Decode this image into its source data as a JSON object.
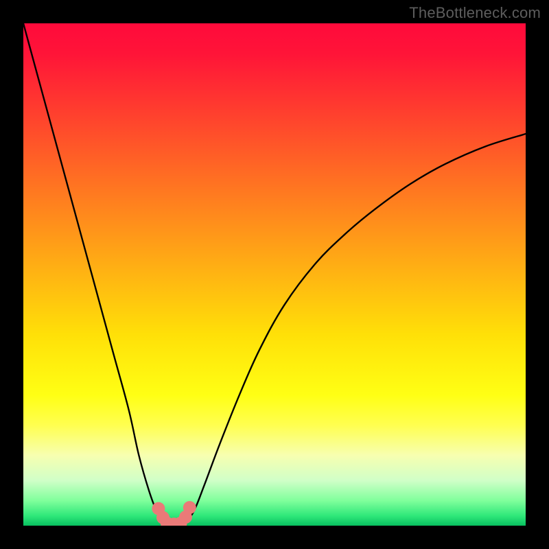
{
  "watermark": "TheBottleneck.com",
  "colors": {
    "curve": "#000000",
    "marker": "#ea7a78",
    "frame": "#000000"
  },
  "chart_data": {
    "type": "line",
    "title": "",
    "xlabel": "",
    "ylabel": "",
    "xlim": [
      0,
      100
    ],
    "ylim": [
      0,
      100
    ],
    "grid": false,
    "legend": false,
    "series": [
      {
        "name": "left-curve",
        "x": [
          0,
          3,
          6,
          9,
          12,
          15,
          18,
          21,
          23,
          25,
          26.5,
          28,
          29
        ],
        "y": [
          100,
          89,
          78,
          67,
          56,
          45,
          34,
          23,
          14,
          7,
          3,
          0.8,
          0
        ]
      },
      {
        "name": "right-curve",
        "x": [
          32,
          34,
          36,
          39,
          43,
          47,
          52,
          58,
          64,
          70,
          77,
          84,
          92,
          100
        ],
        "y": [
          0,
          3,
          8,
          16,
          26,
          35,
          44,
          52,
          58,
          63,
          68,
          72,
          75.5,
          78
        ]
      }
    ],
    "markers": {
      "name": "highlight-points",
      "color": "#ea7a78",
      "points": [
        {
          "x": 26.9,
          "y": 3.4
        },
        {
          "x": 27.8,
          "y": 1.6
        },
        {
          "x": 28.6,
          "y": 0.5
        },
        {
          "x": 30.0,
          "y": 0.3
        },
        {
          "x": 31.3,
          "y": 0.5
        },
        {
          "x": 32.3,
          "y": 1.7
        },
        {
          "x": 33.1,
          "y": 3.6
        }
      ]
    }
  }
}
